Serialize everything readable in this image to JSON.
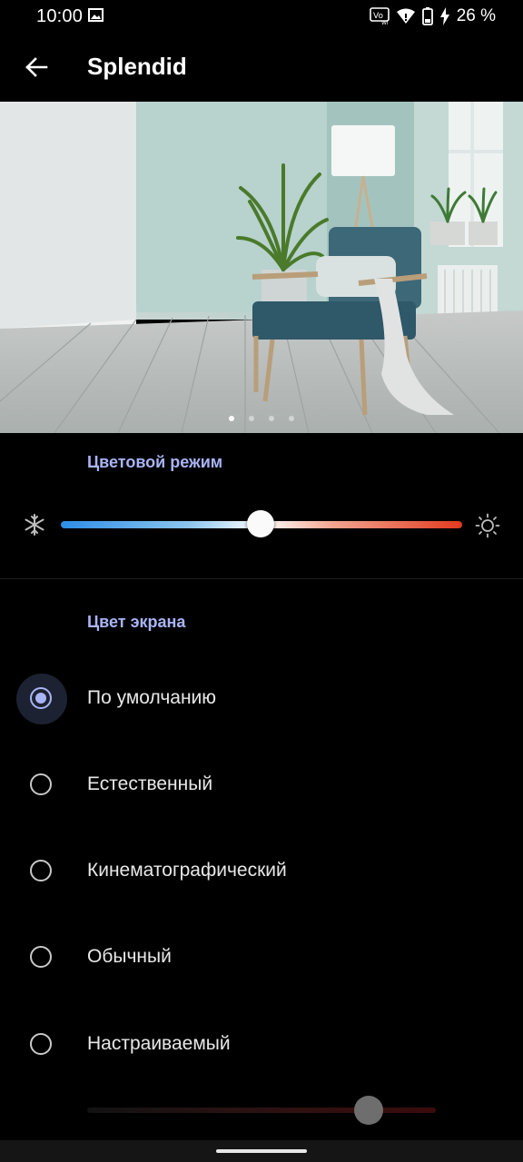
{
  "status_bar": {
    "time": "10:00",
    "battery_percent": "26 %",
    "icons": [
      "image-icon",
      "vowifi-icon",
      "wifi-icon",
      "battery-icon",
      "charging-icon"
    ]
  },
  "app_bar": {
    "title": "Splendid",
    "back_icon": "arrow-left-icon"
  },
  "preview": {
    "page_indicator": {
      "count": 4,
      "active_index": 0
    }
  },
  "color_mode": {
    "label": "Цветовой режим",
    "left_icon": "snowflake-icon",
    "right_icon": "sun-icon",
    "slider_value": 0.5,
    "gradient_colors": [
      "#2d8de6",
      "#ffffff",
      "#e23a1e"
    ]
  },
  "screen_color": {
    "label": "Цвет экрана",
    "options": [
      {
        "label": "По умолчанию",
        "selected": true
      },
      {
        "label": "Естественный",
        "selected": false
      },
      {
        "label": "Кинематографический",
        "selected": false
      },
      {
        "label": "Обычный",
        "selected": false
      },
      {
        "label": "Настраиваемый",
        "selected": false
      }
    ],
    "custom_slider_value": 0.8
  },
  "colors": {
    "accent": "#a9b4f5",
    "background": "#000000"
  }
}
